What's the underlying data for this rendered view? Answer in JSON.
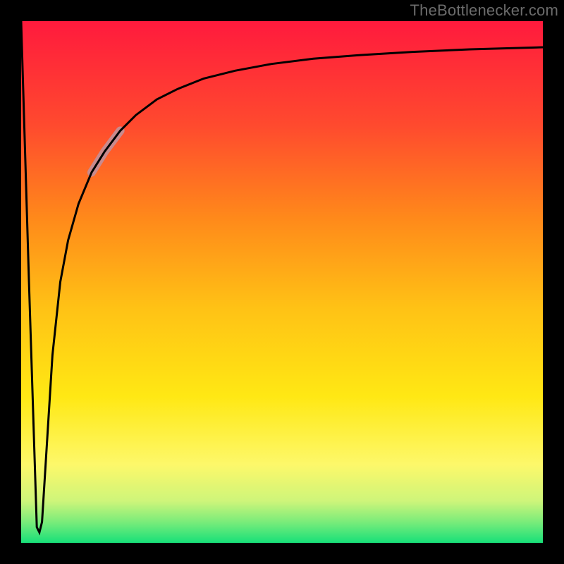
{
  "watermark": "TheBottlenecker.com",
  "chart_data": {
    "type": "line",
    "title": "",
    "xlabel": "",
    "ylabel": "",
    "xlim": [
      0,
      100
    ],
    "ylim": [
      0,
      100
    ],
    "annotations": [],
    "series": [
      {
        "name": "bottleneck-curve",
        "x": [
          0.0,
          1.5,
          3.0,
          3.5,
          4.0,
          5.0,
          6.0,
          7.5,
          9.0,
          11.0,
          13.5,
          16.0,
          19.0,
          22.0,
          26.0,
          30.0,
          35.0,
          41.0,
          48.0,
          56.0,
          65.0,
          75.0,
          86.0,
          100.0
        ],
        "y": [
          100.0,
          50.0,
          3.0,
          2.0,
          4.0,
          20.0,
          36.0,
          50.0,
          58.0,
          65.0,
          71.0,
          75.0,
          79.0,
          82.0,
          85.0,
          87.0,
          89.0,
          90.5,
          91.8,
          92.8,
          93.5,
          94.1,
          94.6,
          95.0
        ]
      }
    ],
    "highlight_segment": {
      "series": "bottleneck-curve",
      "x_start": 13.5,
      "x_end": 19.0,
      "color": "#c98a8d",
      "width": 12
    },
    "background_gradient": {
      "stops": [
        {
          "offset": 0.0,
          "color": "#ff1a3d"
        },
        {
          "offset": 0.2,
          "color": "#ff4a2e"
        },
        {
          "offset": 0.38,
          "color": "#ff8a1a"
        },
        {
          "offset": 0.55,
          "color": "#ffc215"
        },
        {
          "offset": 0.72,
          "color": "#ffe814"
        },
        {
          "offset": 0.85,
          "color": "#fdf86a"
        },
        {
          "offset": 0.92,
          "color": "#cef57a"
        },
        {
          "offset": 0.96,
          "color": "#7aec7a"
        },
        {
          "offset": 1.0,
          "color": "#17e079"
        }
      ]
    },
    "frame": {
      "stroke": "#000000",
      "stroke_width": 30
    }
  }
}
